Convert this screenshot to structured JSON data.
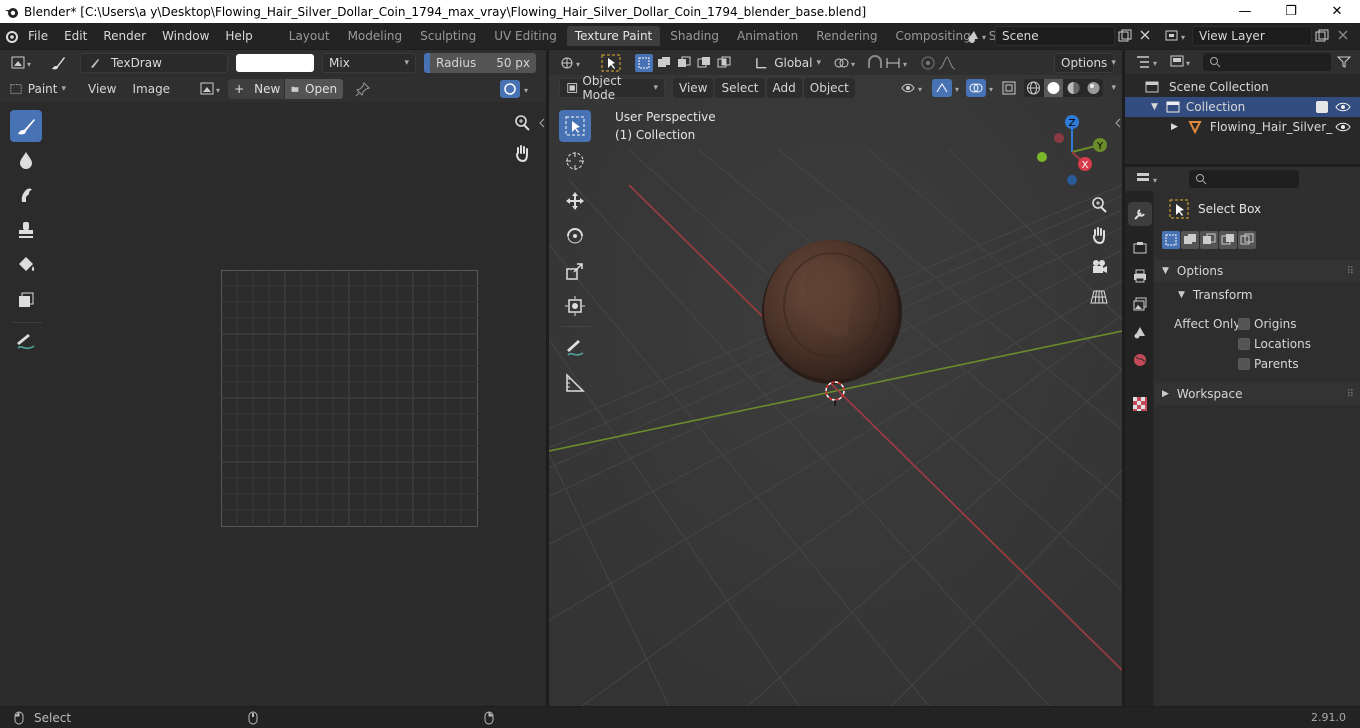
{
  "window": {
    "title": "Blender* [C:\\Users\\a y\\Desktop\\Flowing_Hair_Silver_Dollar_Coin_1794_max_vray\\Flowing_Hair_Silver_Dollar_Coin_1794_blender_base.blend]",
    "minimize": "—",
    "maximize": "❐",
    "close": "✕"
  },
  "menu": [
    "File",
    "Edit",
    "Render",
    "Window",
    "Help"
  ],
  "workspaces": [
    {
      "label": "Layout"
    },
    {
      "label": "Modeling"
    },
    {
      "label": "Sculpting"
    },
    {
      "label": "UV Editing"
    },
    {
      "label": "Texture Paint"
    },
    {
      "label": "Shading"
    },
    {
      "label": "Animation"
    },
    {
      "label": "Rendering"
    },
    {
      "label": "Compositing"
    },
    {
      "label": "Scripting"
    }
  ],
  "workspace_add": "+",
  "scene": {
    "name": "Scene",
    "view_layer": "View Layer"
  },
  "image_editor": {
    "brush_name": "TexDraw",
    "blend_mode": "Mix",
    "radius_label": "Radius",
    "radius_value": "50 px",
    "mode": "Paint",
    "menus": [
      "View",
      "Image"
    ],
    "new_label": "New",
    "open_label": "Open"
  },
  "viewport": {
    "orientation": "Global",
    "options_label": "Options",
    "mode": "Object Mode",
    "menus": [
      "View",
      "Select",
      "Add",
      "Object"
    ],
    "perspective": "User Perspective",
    "collection": "(1) Collection",
    "gizmo": {
      "x": "X",
      "y": "Y",
      "z": "Z"
    }
  },
  "outliner": {
    "scene_collection": "Scene Collection",
    "collection": "Collection",
    "object": "Flowing_Hair_Silver_"
  },
  "properties": {
    "tool_name": "Select Box",
    "options_label": "Options",
    "transform_label": "Transform",
    "affect_only": "Affect Only",
    "origins": "Origins",
    "locations": "Locations",
    "parents": "Parents",
    "workspace_label": "Workspace"
  },
  "status": {
    "select": "Select",
    "version": "2.91.0"
  },
  "colors": {
    "accent": "#4772b3",
    "x_axis": "#a23a43",
    "y_axis": "#6a8c2a",
    "z_axis": "#2e7bd8"
  }
}
